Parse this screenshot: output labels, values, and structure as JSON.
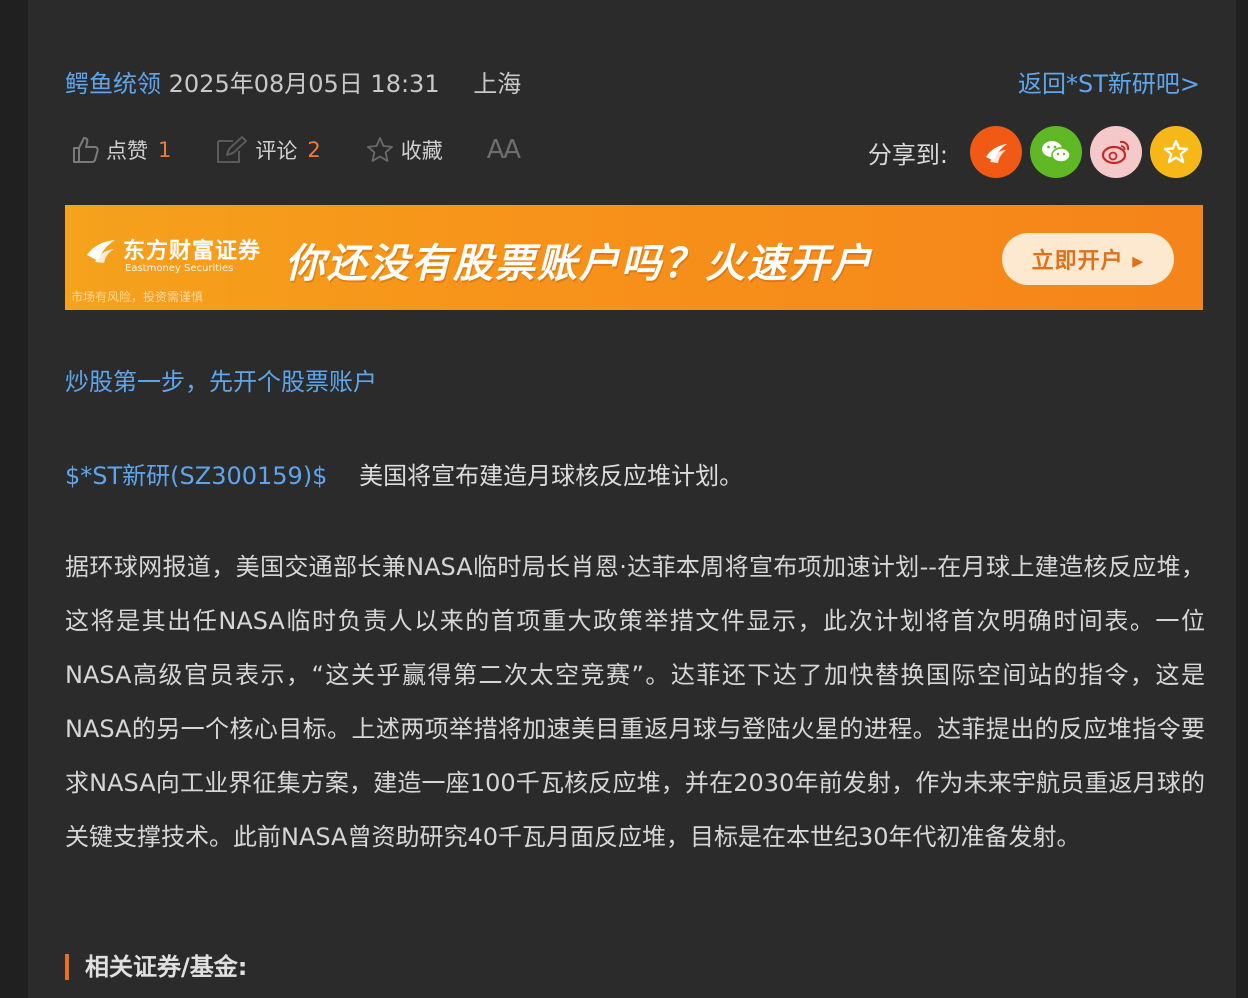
{
  "header": {
    "author": "鳄鱼统领",
    "datetime": "2025年08月05日 18:31",
    "location": "上海",
    "back_link": "返回*ST新研吧>"
  },
  "actions": {
    "like_label": "点赞",
    "like_count": "1",
    "comment_label": "评论",
    "comment_count": "2",
    "favorite_label": "收藏",
    "font_size_label": "AA"
  },
  "share": {
    "label": "分享到:",
    "icons": [
      "eastmoney-icon",
      "wechat-icon",
      "weibo-icon",
      "favorite-star-icon"
    ],
    "colors": [
      "#f05a14",
      "#5fb824",
      "#f5c9c9",
      "#f5b818"
    ]
  },
  "banner": {
    "brand_cn": "东方财富证券",
    "brand_en": "Eastmoney Securities",
    "risk_notice": "市场有风险，投资需谨慎",
    "slogan": "你还没有股票账户吗？火速开户",
    "cta": "立即开户 ▸"
  },
  "promo_link": "炒股第一步，先开个股票账户",
  "post": {
    "stock_tag": "$*ST新研(SZ300159)$",
    "headline": "美国将宣布建造月球核反应堆计划。",
    "body": "据环球网报道，美国交通部长兼NASA临时局长肖恩·达菲本周将宣布项加速计划--在月球上建造核反应堆，这将是其出任NASA临时负责人以来的首项重大政策举措文件显示，此次计划将首次明确时间表。一位NASA高级官员表示，“这关乎赢得第二次太空竞赛”。达菲还下达了加快替换国际空间站的指令，这是NASA的另一个核心目标。上述两项举措将加速美目重返月球与登陆火星的进程。达菲提出的反应堆指令要求NASA向工业界征集方案，建造一座100千瓦核反应堆，并在2030年前发射，作为未来宇航员重返月球的关键支撑技术。此前NASA曾资助研究40千瓦月面反应堆，目标是在本世纪30年代初准备发射。"
  },
  "related_heading": "相关证券/基金:",
  "colors": {
    "background": "#2b2b2c",
    "link": "#5ea6ec",
    "accent": "#f07a35",
    "banner": "#f7931a"
  }
}
